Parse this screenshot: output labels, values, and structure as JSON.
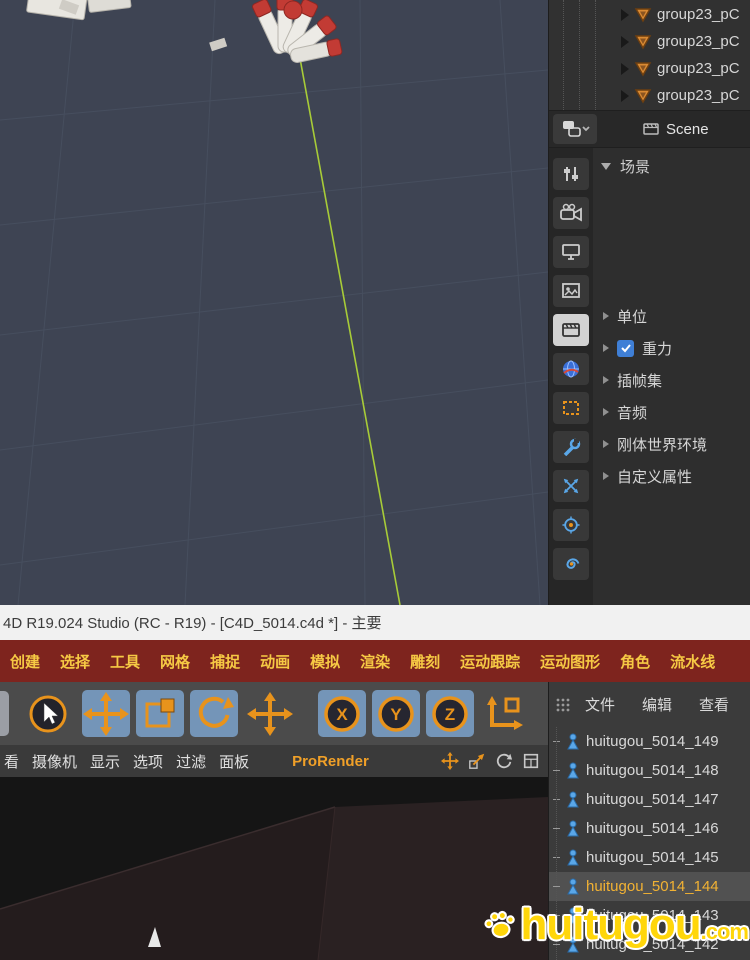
{
  "window": {
    "title": "4D R19.024 Studio (RC - R19) - [C4D_5014.c4d *] - 主要"
  },
  "scene_panel": {
    "object_rows": [
      {
        "label": "group23_pC"
      },
      {
        "label": "group23_pC"
      },
      {
        "label": "group23_pC"
      },
      {
        "label": "group23_pC"
      }
    ],
    "mode_tab": {
      "label": "Scene"
    },
    "header": "场景",
    "items": [
      {
        "label": "单位"
      },
      {
        "label": "重力",
        "checked": true
      },
      {
        "label": "插帧集"
      },
      {
        "label": "音频"
      },
      {
        "label": "刚体世界环境"
      },
      {
        "label": "自定义属性"
      }
    ],
    "icon_strip": [
      "filter-sliders",
      "camera",
      "display",
      "picture",
      "scene",
      "globe",
      "selection-frame",
      "wrench",
      "cross-arrows",
      "target",
      "spiral"
    ]
  },
  "menu_bar": {
    "items": [
      "创建",
      "选择",
      "工具",
      "网格",
      "捕捉",
      "动画",
      "模拟",
      "渲染",
      "雕刻",
      "运动跟踪",
      "运动图形",
      "角色",
      "流水线"
    ]
  },
  "toolbar": {
    "tools": [
      "live-selection",
      "move",
      "scale",
      "rotate",
      "move",
      "axis-x",
      "axis-y",
      "axis-z",
      "coordinate-system"
    ],
    "axis_locks": [
      "X",
      "Y",
      "Z"
    ]
  },
  "object_manager": {
    "menus": [
      "文件",
      "编辑",
      "查看"
    ],
    "rows": [
      {
        "label": "huitugou_5014_149"
      },
      {
        "label": "huitugou_5014_148"
      },
      {
        "label": "huitugou_5014_147"
      },
      {
        "label": "huitugou_5014_146"
      },
      {
        "label": "huitugou_5014_145"
      },
      {
        "label": "huitugou_5014_144",
        "selected": true
      },
      {
        "label": "huitugou_5014_143"
      },
      {
        "label": "huitugou_5014_142"
      }
    ]
  },
  "viewport_menu": {
    "items": [
      "看",
      "摄像机",
      "显示",
      "选项",
      "过滤",
      "面板"
    ],
    "prorender_label": "ProRender",
    "controls": [
      "pan",
      "zoom",
      "rotate-view",
      "toggle-panel"
    ]
  },
  "watermark": {
    "name": "huitugou",
    "tld": ".com"
  },
  "colors": {
    "accent_orange": "#E8931C",
    "highlight_blue": "#7495B8",
    "menu_red": "#7E241E",
    "menu_yellow": "#F6C944",
    "selected_text": "#F2B233",
    "icon_blue": "#5AA7E8",
    "spline_green": "#A8CC38",
    "viewport_top_bg": "#3E4453",
    "viewport_bottom_bg": "#151515"
  }
}
